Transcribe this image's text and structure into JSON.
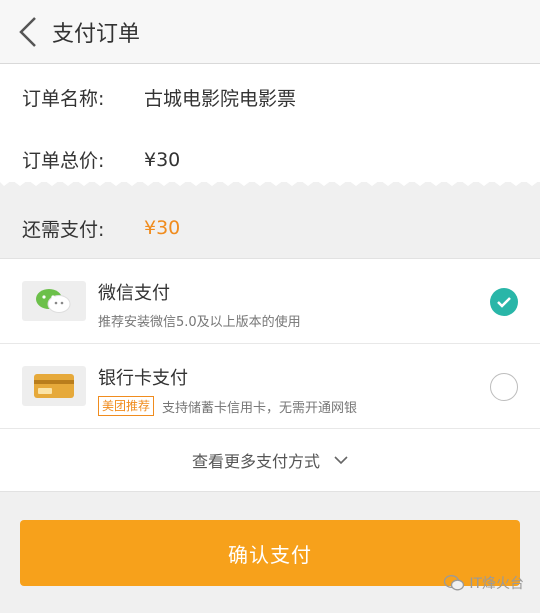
{
  "header": {
    "title": "支付订单"
  },
  "order": {
    "name_label": "订单名称:",
    "name_value": "古城电影院电影票",
    "total_label": "订单总价:",
    "total_value": "¥30"
  },
  "remaining": {
    "label": "还需支付:",
    "value": "¥30"
  },
  "payment_methods": [
    {
      "name": "微信支付",
      "description": "推荐安装微信5.0及以上版本的使用",
      "badge": "",
      "selected": true,
      "icon": "wechat-pay-icon"
    },
    {
      "name": "银行卡支付",
      "description": "支持储蓄卡信用卡，无需开通网银",
      "badge": "美团推荐",
      "selected": false,
      "icon": "bank-card-icon"
    }
  ],
  "more_methods_label": "查看更多支付方式",
  "confirm_label": "确认支付",
  "watermark": "IT烽火台",
  "colors": {
    "accent": "#f7a11b",
    "price": "#f08c1e",
    "check": "#29b6a8"
  }
}
